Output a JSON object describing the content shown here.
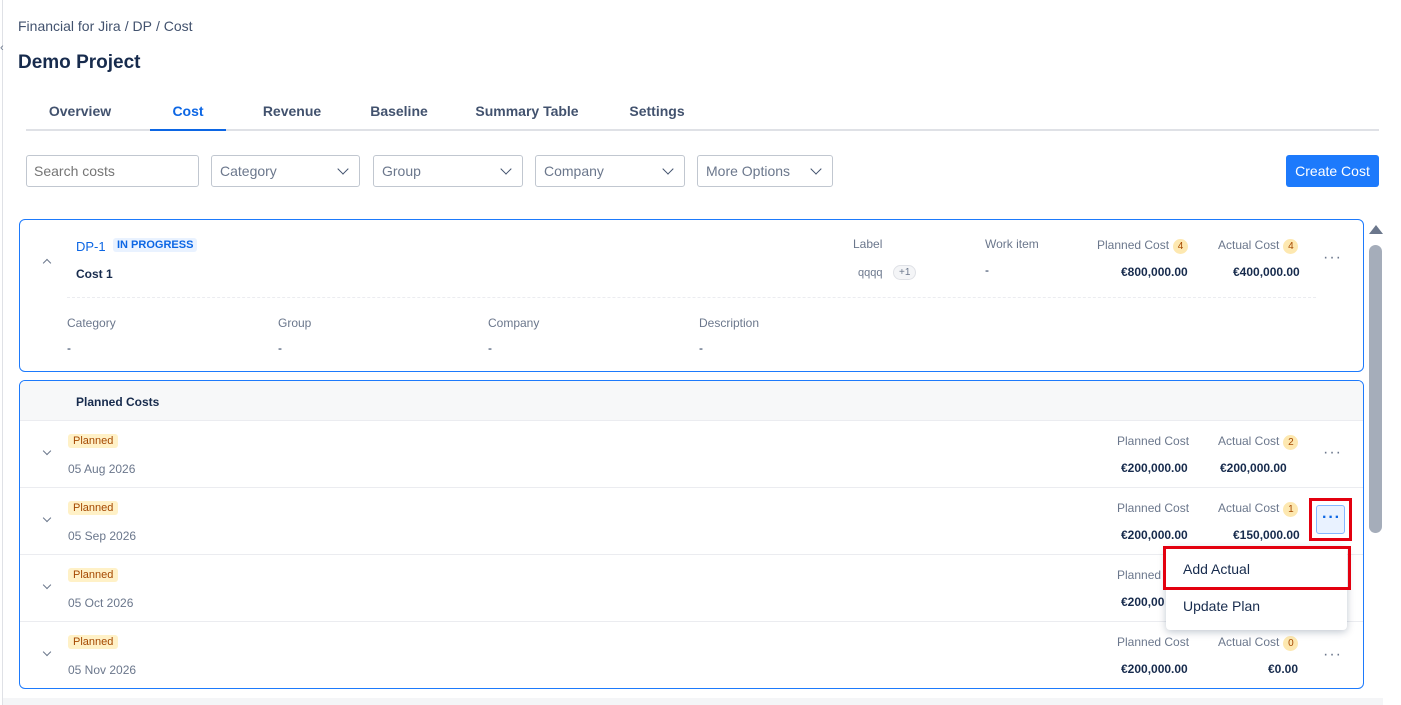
{
  "breadcrumb": [
    "Financial for Jira",
    "/ DP",
    "/ Cost"
  ],
  "page_title": "Demo Project",
  "tabs": [
    "Overview",
    "Cost",
    "Revenue",
    "Baseline",
    "Summary Table",
    "Settings"
  ],
  "toolbar": {
    "search_placeholder": "Search costs",
    "category": "Category",
    "group": "Group",
    "company": "Company",
    "more_options": "More Options",
    "create": "Create Cost"
  },
  "cost": {
    "key": "DP-1",
    "status": "IN PROGRESS",
    "name": "Cost 1",
    "label_header": "Label",
    "label_value": "qqqq",
    "label_more": "+1",
    "work_item_header": "Work item",
    "work_item_value": "-",
    "planned_header": "Planned Cost",
    "planned_count": "4",
    "planned_value": "€800,000.00",
    "actual_header": "Actual Cost",
    "actual_count": "4",
    "actual_value": "€400,000.00",
    "category_header": "Category",
    "category_value": "-",
    "group_header": "Group",
    "group_value": "-",
    "company_header": "Company",
    "company_value": "-",
    "description_header": "Description",
    "description_value": "-"
  },
  "planned_costs": {
    "title": "Planned Costs",
    "rows": [
      {
        "status": "Planned",
        "date": "05 Aug 2026",
        "planned_header": "Planned Cost",
        "planned_value": "€200,000.00",
        "actual_header": "Actual Cost",
        "actual_count": "2",
        "actual_value": "€200,000.00"
      },
      {
        "status": "Planned",
        "date": "05 Sep 2026",
        "planned_header": "Planned Cost",
        "planned_value": "€200,000.00",
        "actual_header": "Actual Cost",
        "actual_count": "1",
        "actual_value": "€150,000.00"
      },
      {
        "status": "Planned",
        "date": "05 Oct 2026",
        "planned_header": "Planned",
        "planned_value": "€200,00"
      },
      {
        "status": "Planned",
        "date": "05 Nov 2026",
        "planned_header": "Planned Cost",
        "planned_value": "€200,000.00",
        "actual_header": "Actual Cost",
        "actual_count": "0",
        "actual_value": "€0.00"
      }
    ]
  },
  "menu": {
    "add_actual": "Add Actual",
    "update_plan": "Update Plan"
  },
  "colors": {
    "accent": "#1d7afc",
    "highlight": "#e3000f",
    "planned_badge_bg": "#fff1c7"
  }
}
